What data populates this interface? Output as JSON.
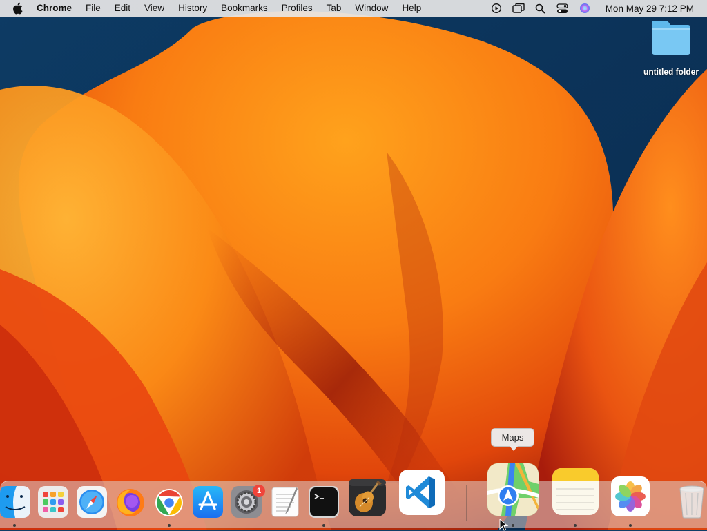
{
  "menubar": {
    "app_name": "Chrome",
    "items": [
      "File",
      "Edit",
      "View",
      "History",
      "Bookmarks",
      "Profiles",
      "Tab",
      "Window",
      "Help"
    ],
    "clock": "Mon May 29  7:12 PM"
  },
  "desktop": {
    "folder_label": "untitled folder"
  },
  "dock": {
    "tooltip": "Maps",
    "settings_badge": "1"
  }
}
